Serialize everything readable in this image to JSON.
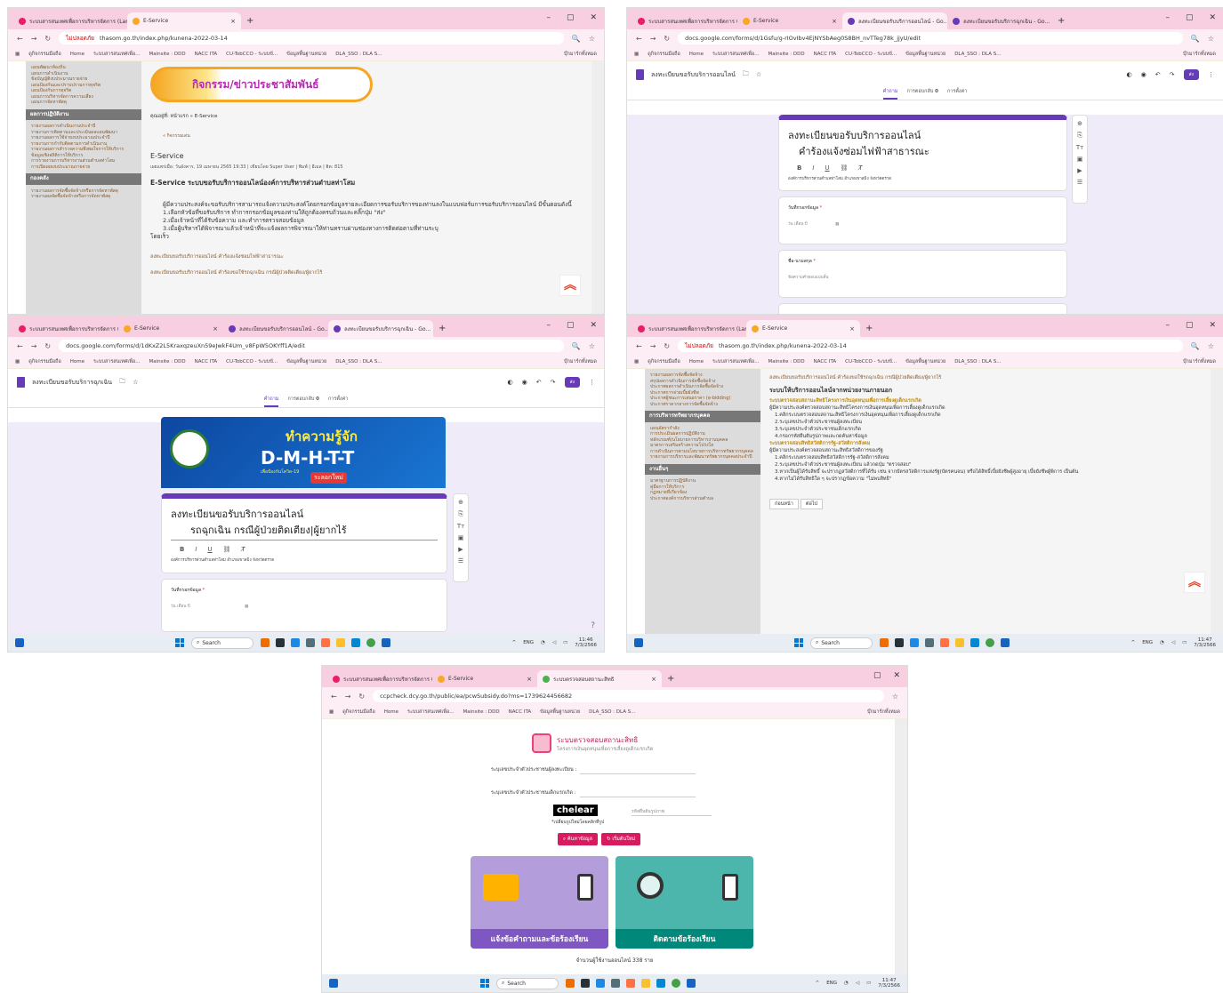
{
  "browser": {
    "tab_thasom": "ระบบสารสนเทศเพื่อการบริหารจัดการ (LandsMa...",
    "tab_eservice": "E-Service",
    "tab_form1": "ลงทะเบียนขอรับบริการออนไลน์ - Go...",
    "tab_form2": "ลงทะเบียนขอรับบริการฉุกเฉิน - Go...",
    "tab_dla": "ระบบตรวจสอบสถานะสิทธิ",
    "url_thasom": "thasom.go.th/index.php/kunena-2022-03-14",
    "url_form1": "docs.google.com/forms/d/1Gsfu/g-rIOvIbv4EjNYSbAeg0S8BH_nvTTeg78k_jjyU/edit",
    "url_form2": "docs.google.com/forms/d/1dKxZ2L5KraxqzeuXn59eJwkF4Um_v8FpW5OKYff1A/edit",
    "url_dla": "ccpcheck.dcy.go.th/public/ea/pcwSubsidy.do?ms=1739624456682",
    "not_secure": "ไม่ปลอดภัย",
    "bookmarks": [
      "ดูกิจกรรมมือถือ",
      "Home",
      "ระบบสารสนเทศเพื่อ...",
      "Mainsite : DDD",
      "NACC ITA",
      "CU-TobCCO - ระบบข้...",
      "ข้อมูลพื้นฐานหน่วย",
      "DLA_SSO : DLA S..."
    ],
    "all_bookmarks": "บุ๊กมาร์กทั้งหมด"
  },
  "taskbar": {
    "search": "Search",
    "lang": "ENG",
    "time1": "11:46",
    "date1": "7/3/2566",
    "time2": "11:47",
    "date2": "7/3/2566"
  },
  "thasom": {
    "banner": "กิจกรรม/ข่าวประชาสัมพันธ์",
    "breadcrumb": "คุณอยู่ที่: หน้าแรก » E-Service",
    "subnav": "« กิจกรรมเด่น",
    "heading": "E-Service",
    "meta": "เผยแพร่เมื่อ: วันอังคาร, 19 เมษายน 2565 19:33 | เขียนโดย Super User | พิมพ์ | อีเมล | ฮิต: 815",
    "title": "E-Service ระบบขอรับบริการออนไลน์องค์การบริหารส่วนตำบลท่าโสม",
    "para": "ผู้มีความประสงค์จะขอรับบริการสามารถแจ้งความประสงค์โดยกรอกข้อมูลรายละเอียดการขอรับบริการของท่านลงในแบบฟอร์มการขอรับบริการออนไลน์ มีขั้นตอนดังนี้",
    "step1": "1.เลือกหัวข้อที่ขอรับบริการ ทำการกรอกข้อมูลของท่านให้ถูกต้องครบถ้วนและคลิ๊กปุ่ม \"ส่ง\"",
    "step2": "2.เมื่อเจ้าหน้าที่ได้รับข้อความ และทำการตรวจสอบข้อมูล",
    "step3": "3.เมื่อผู้บริหารได้พิจารณาแล้วเจ้าหน้าที่จะแจ้งผลการพิจารณาให้ท่านทราบผ่านช่องทางการติดต่อตามที่ท่านระบุ",
    "step3b": "โดยเร็ว",
    "link1": "ลงทะเบียนขอรับบริการออนไลน์ คำร้องแจ้งซ่อมไฟฟ้าสาธารณะ",
    "link2": "ลงทะเบียนขอรับบริการออนไลน์ คำร้องขอใช้รถฉุกเฉิน กรณีผู้ป่วยติดเตียง/ผู้ยากไร้",
    "side_hd1": "ผลการปฏิบัติงาน",
    "side_hd2": "กองคลัง",
    "side_hd3": "การบริหารทรัพยากรบุคคล",
    "side_hd4": "งานอื่นๆ",
    "side_items1": [
      "แผนพัฒนาท้องถิ่น",
      "แผนการดำเนินงาน",
      "ข้อบัญญัติงบประมาณรายจ่าย",
      "แผนป้องกันและปราบปรามการทุจริต",
      "แผนป้องกันการทุจริต",
      "แผนการบริหารจัดการความเสี่ยง",
      "แผนการจัดหาพัสดุ"
    ],
    "side_items2": [
      "รายงานผลการดำเนินงานประจำปี",
      "รายงานการติดตามและประเมินผลแผนพัฒนา",
      "รายงานผลการใช้จ่ายงบประมาณประจำปี",
      "รายงานการกำกับติดตามการดำเนินงาน",
      "รายงานผลการสำรวจความพึงพอใจการให้บริการ",
      "ข้อมูลเชิงสถิติการให้บริการ",
      "การรายงานการบริหารงานส่วนตำบลท่าโสม",
      "การเปิดเผยงบประมาณรายจ่าย"
    ],
    "side_items3": [
      "รายงานผลการจัดซื้อจัดจ้างหรือการจัดหาพัสดุ",
      "รายงานผลจัดซื้อจัดจ้างหรือการจัดหาพัสดุ"
    ]
  },
  "form1": {
    "doc_title": "ลงทะเบียนขอรับบริการออนไลน์",
    "tabs": [
      "คำถาม",
      "การตอบกลับ",
      "การตั้งค่า"
    ],
    "responses": "0",
    "send": "ส่ง",
    "title_line1": "ลงทะเบียนขอรับบริการออนไลน์",
    "title_line2": "คำร้องแจ้งซ่อมไฟฟ้าสาธารณะ",
    "desc": "องค์การบริหารส่วนตำบลท่าโสม อำเภอเขาสมิง จังหวัดตราด",
    "q1": "วันที่กรอกข้อมูล",
    "q1_hint": "วัน เดือน ปี",
    "q2": "ชื่อ-นามสกุล",
    "q2_hint": "ข้อความคำตอบแบบสั้น"
  },
  "form2": {
    "doc_title": "ลงทะเบียนขอรับบริการฉุกเฉิน",
    "tabs": [
      "คำถาม",
      "การตอบกลับ",
      "การตั้งค่า"
    ],
    "responses": "0",
    "send": "ส่ง",
    "banner_line1": "ทำความรู้จัก",
    "banner_line2": "D-M-H-T-T",
    "banner_tag": "ระลอกใหม่",
    "banner_small": "เพื่อป้องกันโควิด-19",
    "title_line1": "ลงทะเบียนขอรับบริการออนไลน์",
    "title_line2": "รถฉุกเฉิน กรณีผู้ป่วยติดเตียง|ผู้ยากไร้",
    "desc": "องค์การบริหารส่วนตำบลท่าโสม อำเภอเขาสมิง จังหวัดตราด",
    "q1": "วันที่กรอกข้อมูล",
    "q1_hint": "วัน เดือน ปี"
  },
  "thasom2": {
    "top_link": "ลงทะเบียนขอรับบริการออนไลน์ คำร้องขอใช้รถฉุกเฉิน กรณีผู้ป่วยติดเตียง/ผู้ยากไร้",
    "heading": "ระบบให้บริการออนไลน์จากหน่วยงานภายนอก",
    "sub1": "ระบบตรวจสอบสถานะสิทธิโครงการเงินอุดหนุนเพื่อการเลี้ยงดูเด็กแรกเกิด",
    "p1": "ผู้มีความประสงค์ตรวจสอบสถานะสิทธิโครงการเงินอุดหนุนเพื่อการเลี้ยงดูเด็กแรกเกิด",
    "s1": "1.คลิกระบบตรวจสอบสถานะสิทธิโครงการเงินอุดหนุนเพื่อการเลี้ยงดูเด็กแรกเกิด",
    "s2": "2.ระบุเลขประจำตัวประชาชนผู้ลงทะเบียน",
    "s3": "3.ระบุเลขประจำตัวประชาชนเด็กแรกเกิด",
    "s4": "4.กรอกรหัสยืนยันรูปภาพและกดค้นหาข้อมูล",
    "sub2": "ระบบตรวจสอบสิทธิสวัสดิการรัฐ-สวัสดิการสังคม",
    "p2": "ผู้มีความประสงค์ตรวจสอบสถานะสิทธิสวัสดิการของรัฐ",
    "t1": "1.คลิกระบบตรวจสอบสิทธิสวัสดิการรัฐ-สวัสดิการสังคม",
    "t2": "2.ระบุเลขประจำตัวประชาชนผู้ลงทะเบียน แล้วกดปุ่ม \"ตรวจสอบ\"",
    "t3": "3.หากเป็นผู้ได้รับสิทธิ์ จะปรากฏสวัสดิการที่ได้รับ เช่น จากบัตรสวัสดิการแห่งรัฐ(บัตรคนจน) หรือได้สิทธิ์เบี้ยยังชีพผู้สูงอายุ เบี้ยยังชีพผู้พิการ เป็นต้น",
    "t4": "4.หากไม่ได้รับสิทธิใด ๆ จะปรากฏข้อความ \"ไม่พบสิทธิ\"",
    "prev": "ก่อนหน้า",
    "next": "ต่อไป",
    "side_hd1": "การบริหารทรัพยากรบุคคล",
    "side_hd2": "งานอื่นๆ",
    "side_items1": [
      "รายงานผลการจัดซื้อจัดจ้าง",
      "สรุปผลการดำเนินการจัดซื้อจัดจ้าง",
      "ประกาศผลการดำเนินการจัดซื้อจัดจ้าง",
      "ประกาศการจ่ายเบี้ยยังชีพ",
      "ประกาศผู้ชนะการเสนอราคา (e-bidding)",
      "ประกาศราคากลางการจัดซื้อจัดจ้าง"
    ],
    "side_items2": [
      "แผนอัตรากำลัง",
      "การประเมินผลการปฏิบัติงาน",
      "หลักเกณฑ์/นโยบายการบริหารงานบุคคล",
      "มาตรการเสริมสร้างความโปร่งใส",
      "การดำเนินการตามนโยบายการบริหารทรัพยากรบุคคล",
      "รายงานการบริหารและพัฒนาทรัพยากรบุคคลประจำปี"
    ],
    "side_items3": [
      "มาตรฐานการปฏิบัติงาน",
      "คู่มือการให้บริการ",
      "กฎหมายที่เกี่ยวข้อง",
      "ประกาศองค์การบริหารส่วนตำบล"
    ]
  },
  "dla": {
    "title1": "ระบบตรวจสอบสถานะสิทธิ",
    "title2": "โครงการเงินอุดหนุนเพื่อการเลี้ยงดูเด็กแรกเกิด",
    "label1": "ระบุเลขประจำตัวประชาชนผู้ลงทะเบียน :",
    "label2": "ระบุเลขประจำตัวประชาชนเด็กแรกเกิด :",
    "captcha": "chelear",
    "captcha_hint": "รหัสยืนยันรูปภาพ",
    "captcha_note": "*เปลี่ยนรูปใหม่โดยคลิกที่รูป",
    "search_btn": "ค้นหาข้อมูล",
    "reset_btn": "เริ่มต้นใหม่",
    "card1": "แจ้งข้อคำถามและข้อร้องเรียน",
    "card2": "ติดตามข้อร้องเรียน",
    "visitors": "จำนวนผู้ใช้งานออนไลน์ 338 ราย"
  },
  "colors": {
    "tabstrip": "#f7cfe0",
    "forms_purple": "#673ab7",
    "dla_pink": "#d81b60",
    "card1": "#b39ddb",
    "card2": "#4db6ac"
  }
}
